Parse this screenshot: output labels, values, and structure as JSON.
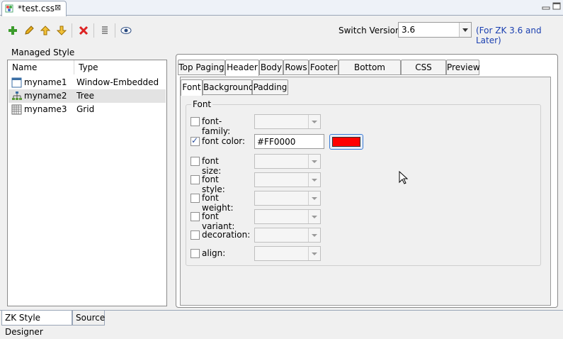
{
  "editor": {
    "tab_title": "*test.css",
    "close_glyph": "⊠"
  },
  "toolbar": {
    "switch_label": "Switch Version:",
    "version_value": "3.6",
    "version_note": "(For ZK 3.6 and Later)",
    "icons": [
      "add-icon",
      "edit-pencil-icon",
      "move-up-icon",
      "move-down-icon",
      "delete-icon",
      "list-icon",
      "preview-eye-icon"
    ]
  },
  "managed": {
    "legend": "Managed Style",
    "columns": [
      "Name",
      "Type"
    ],
    "rows": [
      {
        "name": "myname1",
        "type": "Window-Embedded",
        "icon": "window-icon"
      },
      {
        "name": "myname2",
        "type": "Tree",
        "icon": "tree-icon"
      },
      {
        "name": "myname3",
        "type": "Grid",
        "icon": "grid-icon"
      }
    ]
  },
  "tabs": [
    "Top Paging",
    "Header",
    "Body",
    "Rows",
    "Footer",
    "Bottom Paging",
    "CSS Result",
    "Preview"
  ],
  "active_tab": "Header",
  "subtabs": [
    "Font",
    "Background",
    "Padding"
  ],
  "active_subtab": "Font",
  "font_group": {
    "legend": "Font",
    "props": [
      {
        "label": "font-family:",
        "checked": false
      },
      {
        "label": "font color:",
        "checked": true,
        "value": "#FF0000"
      },
      {
        "label": "font size:",
        "checked": false
      },
      {
        "label": "font style:",
        "checked": false
      },
      {
        "label": "font weight:",
        "checked": false
      },
      {
        "label": "font variant:",
        "checked": false
      },
      {
        "label": "decoration:",
        "checked": false
      },
      {
        "label": "align:",
        "checked": false
      }
    ],
    "swatch_color": "#ff0000"
  },
  "bottom_tabs": [
    "ZK Style Designer",
    "Source"
  ]
}
